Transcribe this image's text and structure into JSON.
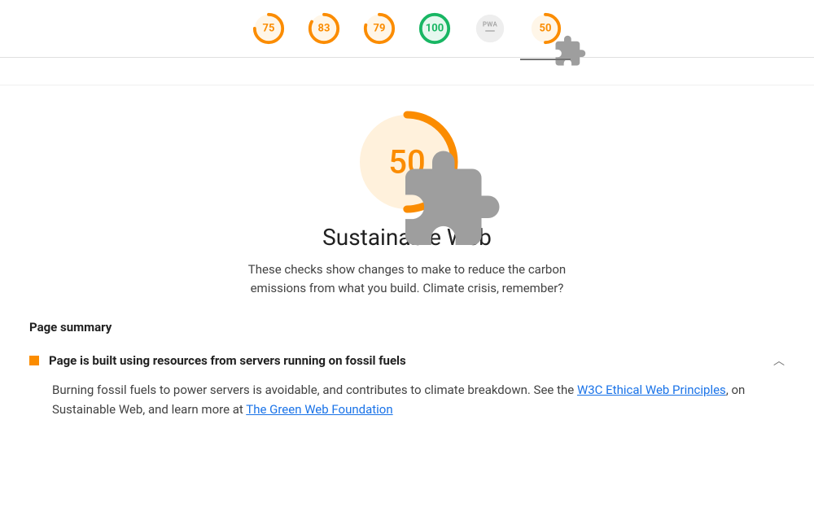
{
  "topbar": {
    "scores": [
      {
        "value": 75,
        "state": "orange"
      },
      {
        "value": 83,
        "state": "orange"
      },
      {
        "value": 79,
        "state": "orange"
      },
      {
        "value": 100,
        "state": "green"
      },
      {
        "value": null,
        "state": "grey",
        "label": "PWA"
      },
      {
        "value": 50,
        "state": "orange",
        "plugin": true,
        "selected": true
      }
    ]
  },
  "hero": {
    "score": 50,
    "title": "Sustainable Web",
    "subtitle": "These checks show changes to make to reduce the carbon emissions from what you build. Climate crisis, remember?"
  },
  "section": {
    "heading": "Page summary"
  },
  "audit": {
    "title": "Page is built using resources from servers running on fossil fuels",
    "body_prefix": "Burning fossil fuels to power servers is avoidable, and contributes to climate breakdown. See the ",
    "link1_text": "W3C Ethical Web Principles",
    "body_mid": ", on Sustainable Web, and learn more at ",
    "link2_text": "The Green Web Foundation"
  },
  "colors": {
    "orange": "#fb8c00",
    "green": "#18b663",
    "grey": "#bdbdbd",
    "link": "#1a73e8"
  }
}
